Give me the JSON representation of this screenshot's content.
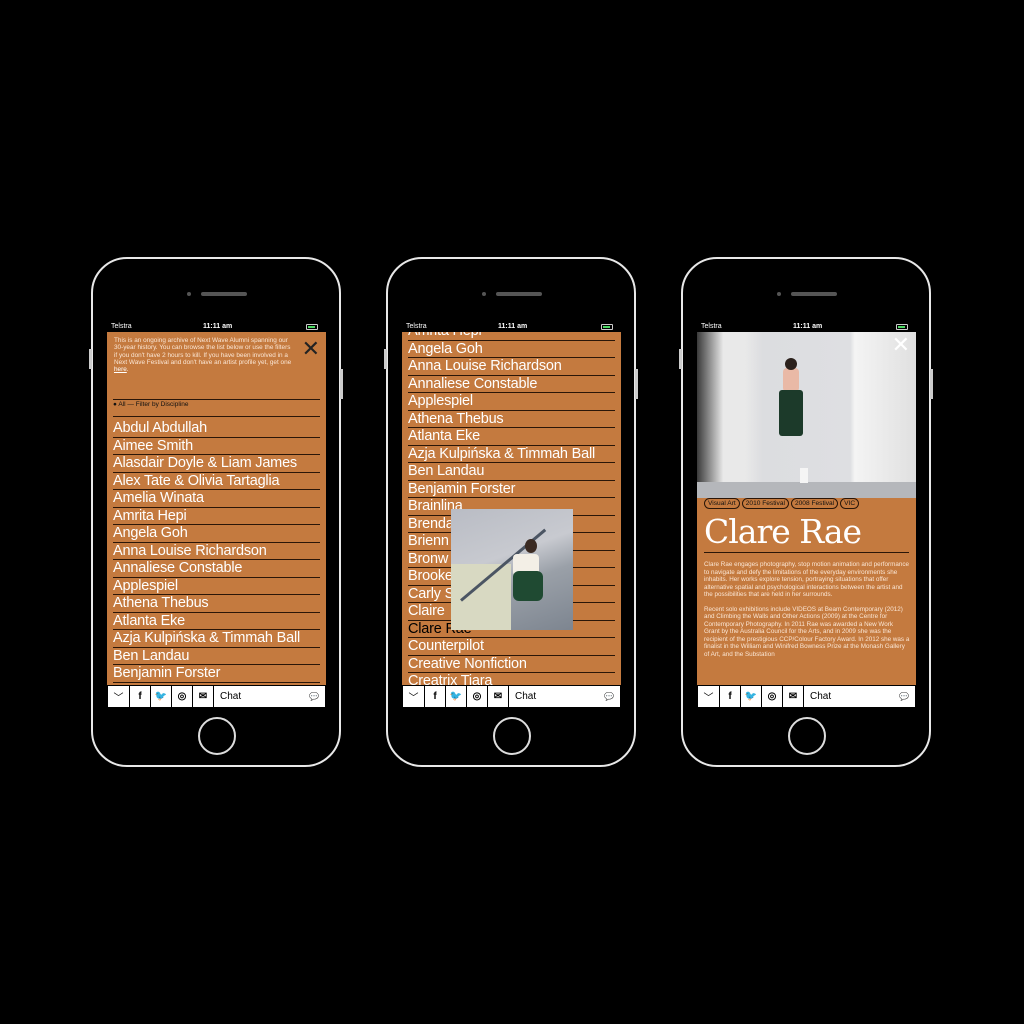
{
  "colors": {
    "accent": "#c47a3f",
    "background": "#000000"
  },
  "status": {
    "carrier": "Telstra",
    "time": "11:11 am"
  },
  "bottom_bar": {
    "chat_label": "Chat",
    "icons": [
      "chevron-down-icon",
      "facebook-icon",
      "twitter-icon",
      "instagram-icon",
      "mail-icon",
      "chat-bubble-icon"
    ]
  },
  "phone1": {
    "intro": "This is an ongoing archive of Next Wave Alumni spanning our 30-year history. You can browse the list below or use the filters if you don't have 2 hours to kill. If you have been involved in a Next Wave Festival and don't have an artist profile yet, get one",
    "intro_link": "here",
    "filter": "● All — Filter by Discipline",
    "items": [
      "Abdul Abdullah",
      "Aimee Smith",
      "Alasdair Doyle & Liam James",
      "Alex Tate & Olivia Tartaglia",
      "Amelia Winata",
      "Amrita Hepi",
      "Angela Goh",
      "Anna Louise Richardson",
      "Annaliese Constable",
      "Applespiel",
      "Athena Thebus",
      "Atlanta Eke",
      "Azja Kulpińska & Timmah Ball",
      "Ben Landau",
      "Benjamin Forster"
    ]
  },
  "phone2": {
    "items": [
      "Amrita Hepi",
      "Angela Goh",
      "Anna Louise Richardson",
      "Annaliese Constable",
      "Applespiel",
      "Athena Thebus",
      "Atlanta Eke",
      "Azja Kulpińska & Timmah Ball",
      "Ben Landau",
      "Benjamin Forster",
      "Brainlina",
      "Brenda",
      "Brienn",
      "Bronw",
      "Brooke",
      "Carly S",
      "Claire",
      "Clare Rae",
      "Counterpilot",
      "Creative Nonfiction",
      "Creatrix Tiara"
    ],
    "active": "Clare Rae"
  },
  "phone3": {
    "tags": [
      "Visual Art",
      "2010 Festival",
      "2008 Festival",
      "VIC"
    ],
    "name": "Clare Rae",
    "bio1": "Clare Rae engages photography, stop motion animation and performance to navigate and defy the limitations of the everyday environments she inhabits. Her works explore tension, portraying situations that offer alternative spatial and psychological interactions between the artist and the possibilities that are held in her surrounds.",
    "bio2": "Recent solo exhibitions include VIDEOS at Beam Contemporary (2012) and Climbing the Walls and Other Actions (2009) at the Centre for Contemporary Photography. In 2011 Rae was awarded a New Work Grant by the Australia Council for the Arts, and in 2009 she was the recipient of the prestigious CCP/Colour Factory Award. In 2012 she was a finalist in the William and Winifred Bowness Prize at the Monash Gallery of Art, and the Substation"
  }
}
